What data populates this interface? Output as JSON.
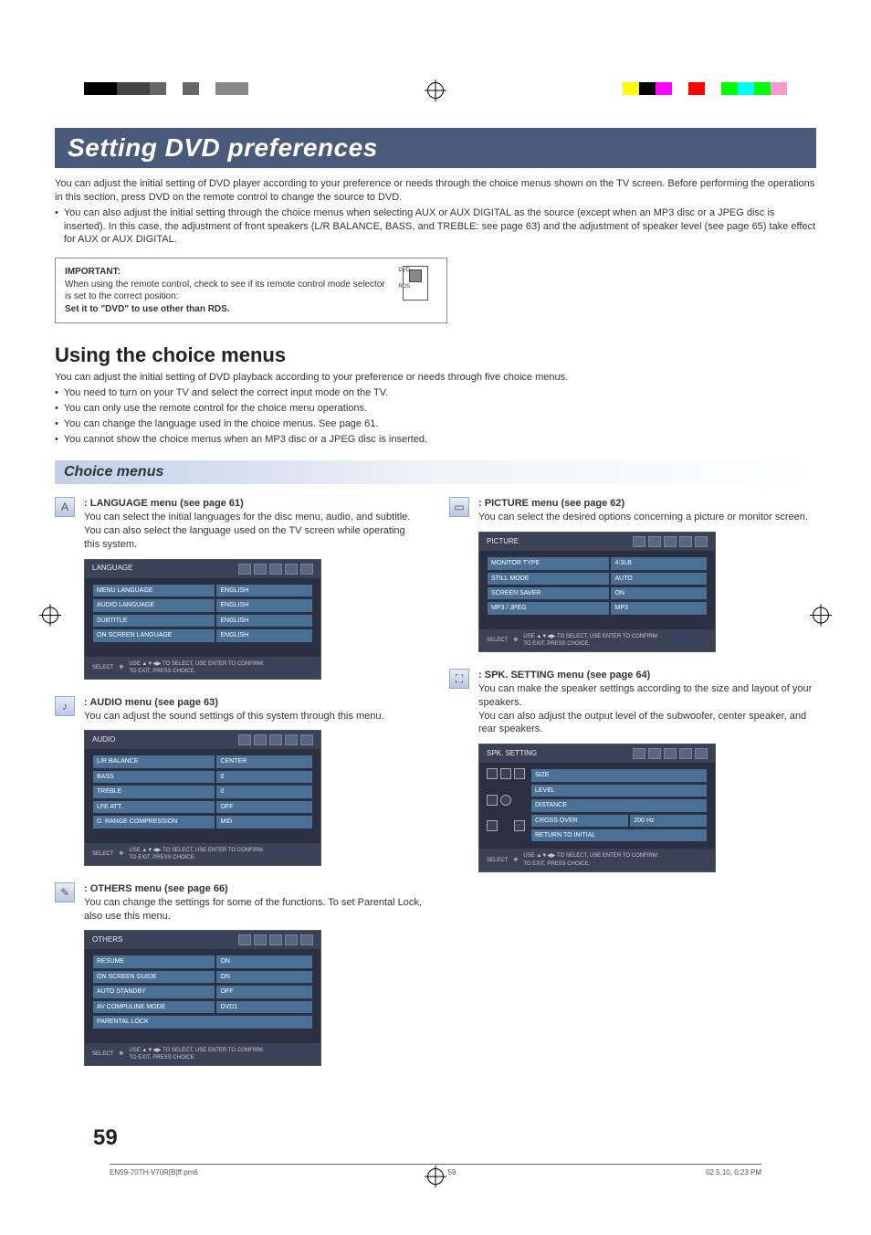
{
  "colorbars": {
    "left": [
      "#000000",
      "#000000",
      "#444444",
      "#444444",
      "#666666",
      "#ffffff",
      "#666666",
      "#ffffff",
      "#888888",
      "#888888"
    ],
    "right": [
      "#ffff00",
      "#000000",
      "#ff00ff",
      "#ffffff",
      "#ff0000",
      "#ffffff",
      "#00ff00",
      "#00ffff",
      "#00ff00",
      "#ff99cc"
    ]
  },
  "title": "Setting DVD preferences",
  "intro_line1": "You can adjust the initial setting of DVD player according to your preference or needs through the choice menus shown on the TV screen. Before performing the operations in this section, press DVD on the remote control to change the source to DVD.",
  "intro_bullet": "You can also adjust the initial setting through the choice menus when selecting AUX or AUX DIGITAL as the source (except when an MP3 disc or a JPEG disc is inserted). In this case, the adjustment of front speakers (L/R BALANCE, BASS, and TREBLE: see page 63) and the adjustment of speaker level (see page 65) take effect for AUX or AUX DIGITAL.",
  "important": {
    "title": "IMPORTANT:",
    "body": "When using the remote control, check to see if its remote control mode selector is set to the correct position:",
    "bold": "Set it to \"DVD\" to use other than RDS.",
    "switch_top": "DVD",
    "switch_bot": "RDS"
  },
  "using": {
    "heading": "Using the choice menus",
    "lead": "You can adjust the initial setting of DVD playback according to your preference or needs through five choice menus.",
    "bullets": [
      "You need to turn on your TV and select the correct input mode on the TV.",
      "You can only use the remote control for the choice menu operations.",
      "You can change the language used in the choice menus. See page 61.",
      "You cannot show the choice menus when an MP3 disc or a JPEG disc is inserted."
    ]
  },
  "choice_header": "Choice menus",
  "osd_footer": {
    "select": "SELECT",
    "enter": "ENTER",
    "hint1": "USE ▲▼◀▶ TO SELECT,  USE ENTER TO CONFIRM.",
    "hint2": "TO EXIT, PRESS CHOICE."
  },
  "menus": {
    "language": {
      "icon": "A",
      "heading": "LANGUAGE menu (see page 61)",
      "body": "You can select the initial languages for the disc menu, audio, and subtitle.\nYou can also select the language used on the TV screen while operating this system.",
      "osd_title": "LANGUAGE",
      "rows": [
        [
          "MENU LANGUAGE",
          "ENGLISH"
        ],
        [
          "AUDIO LANGUAGE",
          "ENGLISH"
        ],
        [
          "SUBTITLE",
          "ENGLISH"
        ],
        [
          "ON SCREEN LANGUAGE",
          "ENGLISH"
        ]
      ]
    },
    "audio": {
      "icon": "♪",
      "heading": "AUDIO menu (see page 63)",
      "body": "You can adjust the sound settings of this system through this menu.",
      "osd_title": "AUDIO",
      "rows": [
        [
          "L/R BALANCE",
          "CENTER"
        ],
        [
          "BASS",
          "0"
        ],
        [
          "TREBLE",
          "0"
        ],
        [
          "LFE ATT.",
          "OFF"
        ],
        [
          "D. RANGE COMPRESSION",
          "MID"
        ]
      ]
    },
    "others": {
      "icon": "✎",
      "heading": "OTHERS menu (see page 66)",
      "body": "You can change the settings for some of the functions. To set Parental Lock, also use this menu.",
      "osd_title": "OTHERS",
      "rows": [
        [
          "RESUME",
          "ON"
        ],
        [
          "ON SCREEN GUIDE",
          "ON"
        ],
        [
          "AUTO STANDBY",
          "OFF"
        ],
        [
          "AV COMPULINK MODE",
          "DVD1"
        ],
        [
          "PARENTAL LOCK",
          ""
        ]
      ]
    },
    "picture": {
      "icon": "▭",
      "heading": "PICTURE menu (see page 62)",
      "body": "You can select the desired options concerning a picture or monitor screen.",
      "osd_title": "PICTURE",
      "rows": [
        [
          "MONITOR TYPE",
          "4:3LB"
        ],
        [
          "STILL MODE",
          "AUTO"
        ],
        [
          "SCREEN SAVER",
          "ON"
        ],
        [
          "MP3 / JPEG",
          "MP3"
        ]
      ]
    },
    "spk": {
      "icon": "⛶",
      "heading": "SPK. SETTING menu (see page 64)",
      "body": "You can make the speaker settings according to the size and layout of your speakers.\nYou can also adjust the output level of the subwoofer, center speaker, and rear speakers.",
      "osd_title": "SPK. SETTING",
      "rows": [
        [
          "SIZE",
          ""
        ],
        [
          "LEVEL",
          ""
        ],
        [
          "DISTANCE",
          ""
        ],
        [
          "CROSS OVER",
          "200 Hz"
        ],
        [
          "RETURN TO INITIAL",
          ""
        ]
      ]
    }
  },
  "page_number": "59",
  "footer": {
    "file": "EN59-70TH-V70R[B]ff.pm6",
    "page": "59",
    "date": "02.5.10, 0:23 PM"
  }
}
